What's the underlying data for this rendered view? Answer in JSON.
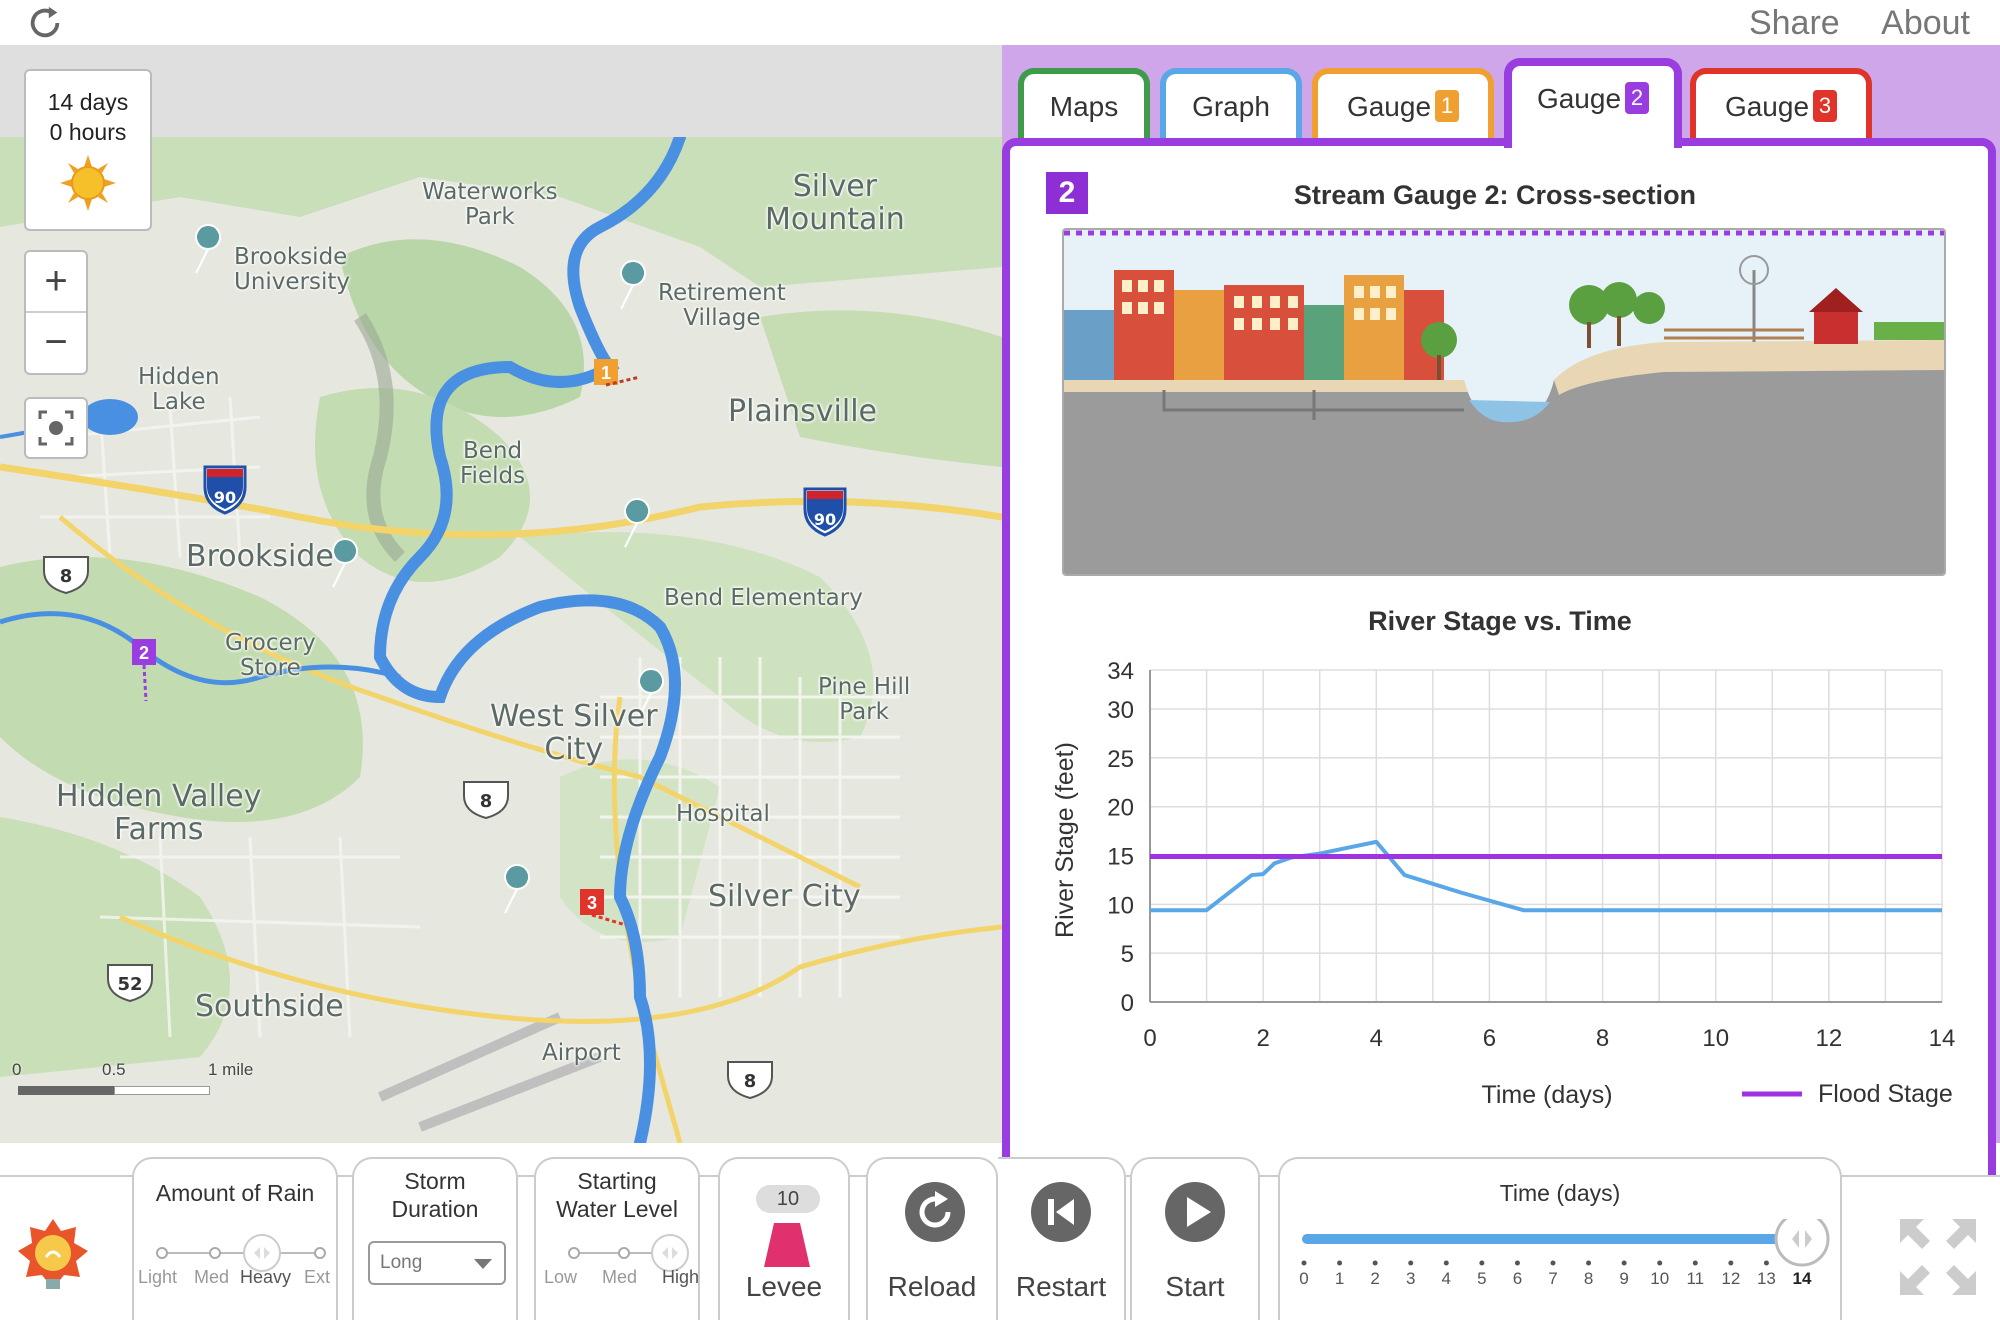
{
  "topbar": {
    "share_label": "Share",
    "about_label": "About"
  },
  "map": {
    "time_days": "14 days",
    "time_hours": "0 hours",
    "zoom_in": "+",
    "zoom_out": "−",
    "scale": {
      "zero": "0",
      "half": "0.5",
      "one": "1 mile"
    },
    "places": {
      "waterworks": [
        "Waterworks",
        "Park"
      ],
      "silver_mountain": [
        "Silver",
        "Mountain"
      ],
      "brookside_university": [
        "Brookside",
        "University"
      ],
      "retirement": [
        "Retirement",
        "Village"
      ],
      "hidden_lake": [
        "Hidden",
        "Lake"
      ],
      "plainsville": "Plainsville",
      "bend_fields": [
        "Bend",
        "Fields"
      ],
      "brookside": "Brookside",
      "bend_elementary": "Bend Elementary",
      "grocery": [
        "Grocery",
        "Store"
      ],
      "pine_hill": [
        "Pine Hill",
        "Park"
      ],
      "west_silver": [
        "West Silver",
        "City"
      ],
      "hidden_valley": [
        "Hidden Valley",
        "Farms"
      ],
      "hospital": "Hospital",
      "silver_city": "Silver City",
      "southside": "Southside",
      "airport": "Airport"
    },
    "shields": {
      "i90_a": "90",
      "i90_b": "90",
      "us8_a": "8",
      "us8_b": "8",
      "us8_c": "8",
      "us52": "52"
    },
    "gauges": {
      "g1": "1",
      "g2": "2",
      "g3": "3"
    }
  },
  "tabs": [
    {
      "label": "Maps",
      "badge": ""
    },
    {
      "label": "Graph",
      "badge": ""
    },
    {
      "label": "Gauge",
      "badge": "1"
    },
    {
      "label": "Gauge",
      "badge": "2"
    },
    {
      "label": "Gauge",
      "badge": "3"
    }
  ],
  "colors": {
    "maps_tab": "#3d9b4a",
    "graph_tab": "#5aa7e8",
    "gauge1": "#f0a030",
    "gauge2": "#9a3de0",
    "gauge3": "#e0332a",
    "river": "#4a90e2",
    "flood_stage": "#a033e0",
    "panel_bg": "#cfa6ea"
  },
  "gauge_panel": {
    "marker": "2",
    "xsection_title": "Stream Gauge 2: Cross-section",
    "chart_title": "River Stage vs. Time"
  },
  "chart_data": {
    "type": "line",
    "title": "River Stage vs. Time",
    "xlabel": "Time (days)",
    "ylabel": "River Stage (feet)",
    "xlim": [
      0,
      14
    ],
    "ylim": [
      0,
      34
    ],
    "x_ticks": [
      0,
      2,
      4,
      6,
      8,
      10,
      12,
      14
    ],
    "y_ticks": [
      0,
      5,
      10,
      15,
      20,
      25,
      30,
      34
    ],
    "grid": true,
    "legend": "bottom-right",
    "series": [
      {
        "color": "#5aa7e8",
        "x": [
          0,
          1,
          1.8,
          2.0,
          2.2,
          2.5,
          3.0,
          3.5,
          4.0,
          4.5,
          5.5,
          6.6,
          8,
          10,
          12,
          14
        ],
        "y": [
          9.4,
          9.4,
          13.0,
          13.1,
          14.2,
          14.8,
          15.2,
          15.8,
          16.4,
          13.0,
          11.2,
          9.4,
          9.4,
          9.4,
          9.4,
          9.4
        ]
      },
      {
        "name": "Flood Stage",
        "color": "#a033e0",
        "x": [
          0,
          14
        ],
        "y": [
          14.9,
          14.9
        ]
      }
    ]
  },
  "controls": {
    "rain": {
      "title": "Amount of Rain",
      "options": [
        "Light",
        "Med",
        "Heavy",
        "Ext"
      ],
      "selected": "Heavy"
    },
    "duration": {
      "title1": "Storm",
      "title2": "Duration",
      "value": "Long"
    },
    "water": {
      "title1": "Starting",
      "title2": "Water Level",
      "options": [
        "Low",
        "Med",
        "High"
      ],
      "selected": "High"
    },
    "levee": {
      "count": "10",
      "label": "Levee"
    },
    "reload": "Reload",
    "restart": "Restart",
    "start": "Start",
    "time": {
      "title": "Time (days)",
      "ticks": [
        "0",
        "1",
        "2",
        "3",
        "4",
        "5",
        "6",
        "7",
        "8",
        "9",
        "10",
        "11",
        "12",
        "13",
        "14"
      ],
      "value": 14,
      "max": 14
    }
  }
}
